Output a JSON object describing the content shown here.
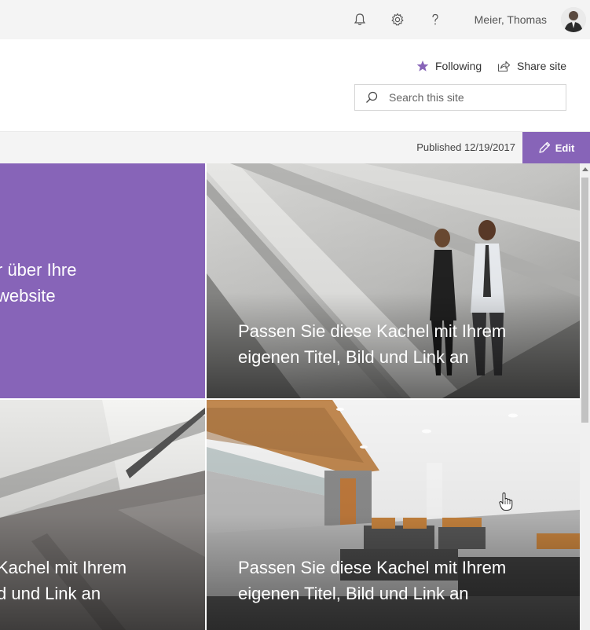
{
  "suitebar": {
    "user_name": "Meier, Thomas",
    "icons": [
      "bell-icon",
      "gear-icon",
      "help-icon"
    ]
  },
  "header": {
    "following_label": "Following",
    "share_label": "Share site",
    "search_placeholder": "Search this site"
  },
  "commandbar": {
    "published": "Published 12/19/2017",
    "edit_label": "Edit"
  },
  "hero": {
    "tiles": [
      {
        "line1": "r über Ihre",
        "line2": "website"
      },
      {
        "line1": "Passen Sie diese Kachel mit Ihrem",
        "line2": "eigenen Titel, Bild und Link an"
      },
      {
        "line1": "Kachel mit Ihrem",
        "line2": "d und Link an"
      },
      {
        "line1": "Passen Sie diese Kachel mit Ihrem",
        "line2": "eigenen Titel, Bild und Link an"
      }
    ]
  },
  "colors": {
    "accent": "#8764b8",
    "suitebar_bg": "#f4f4f4"
  }
}
